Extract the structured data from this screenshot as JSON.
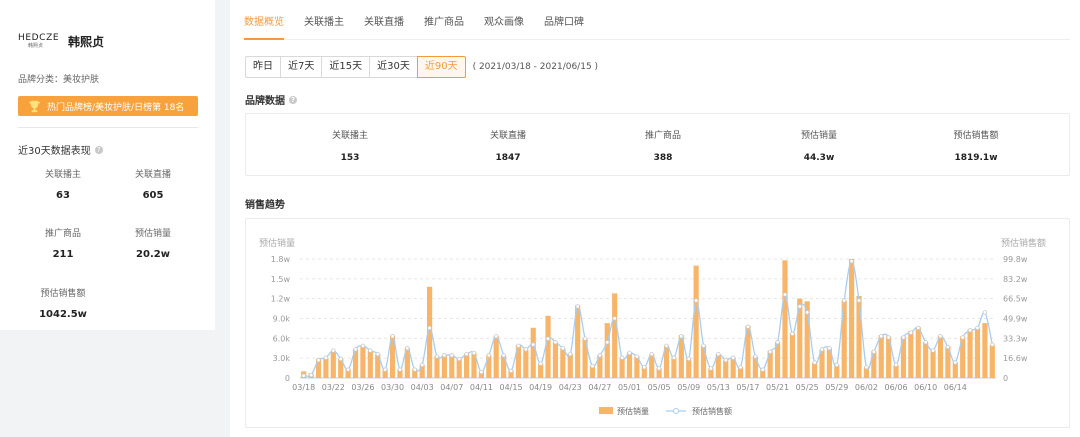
{
  "sidebar": {
    "logo_text": "HEDCZE",
    "logo_sub": "韩熙贞",
    "brand_name": "韩熙贞",
    "category": "品牌分类：美妆护肤",
    "rank_banner": "热门品牌榜/美妆护肤/日榜第 18名",
    "performance_title": "近30天数据表现",
    "stats": [
      {
        "label": "关联播主",
        "value": "63"
      },
      {
        "label": "关联直播",
        "value": "605"
      },
      {
        "label": "推广商品",
        "value": "211"
      },
      {
        "label": "预估销量",
        "value": "20.2w"
      },
      {
        "label": "预估销售额",
        "value": "1042.5w"
      }
    ]
  },
  "tabs": [
    "数据概览",
    "关联播主",
    "关联直播",
    "推广商品",
    "观众画像",
    "品牌口碑"
  ],
  "active_tab": 0,
  "ranges": [
    "昨日",
    "近7天",
    "近15天",
    "近30天",
    "近90天"
  ],
  "active_range": 4,
  "date_range": "( 2021/03/18 - 2021/06/15 )",
  "brand_data": {
    "title": "品牌数据",
    "stats": [
      {
        "label": "关联播主",
        "value": "153"
      },
      {
        "label": "关联直播",
        "value": "1847"
      },
      {
        "label": "推广商品",
        "value": "388"
      },
      {
        "label": "预估销量",
        "value": "44.3w"
      },
      {
        "label": "预估销售额",
        "value": "1819.1w"
      }
    ]
  },
  "trend_title": "销售趋势",
  "colors": {
    "accent": "#f59a3b",
    "bar": "#f7b56a",
    "line": "#a9cdf0"
  },
  "chart_data": {
    "type": "bar",
    "ylabel": "预估销量",
    "y2label": "预估销售额",
    "yticks": [
      "0",
      "3.0k",
      "6.0k",
      "9.0k",
      "1.2w",
      "1.5w",
      "1.8w"
    ],
    "y2ticks": [
      "0",
      "16.6w",
      "33.3w",
      "49.9w",
      "66.5w",
      "83.2w",
      "99.8w"
    ],
    "ylim": [
      0,
      18000
    ],
    "y2lim": [
      0,
      998000
    ],
    "xticks": [
      "03/18",
      "03/22",
      "03/26",
      "03/30",
      "04/03",
      "04/07",
      "04/11",
      "04/15",
      "04/19",
      "04/23",
      "04/27",
      "05/01",
      "05/05",
      "05/09",
      "05/13",
      "05/17",
      "05/21",
      "05/25",
      "05/29",
      "06/02",
      "06/06",
      "06/10",
      "06/14"
    ],
    "legend": [
      "预估销量",
      "预估销售额"
    ],
    "series": [
      {
        "name": "预估销量",
        "values": [
          1000,
          700,
          2900,
          3100,
          4100,
          2900,
          1400,
          4400,
          4900,
          4100,
          3600,
          1400,
          6400,
          1300,
          4600,
          1400,
          2000,
          13800,
          3300,
          3400,
          3500,
          2900,
          3700,
          3800,
          1000,
          3500,
          6400,
          3400,
          1200,
          5000,
          4300,
          7600,
          2200,
          9400,
          5400,
          4500,
          3700,
          11000,
          6000,
          1800,
          3500,
          8300,
          12800,
          3000,
          3900,
          3300,
          1700,
          3600,
          1500,
          4900,
          3100,
          6500,
          2900,
          17000,
          4900,
          1500,
          3600,
          2700,
          3100,
          1700,
          7900,
          3300,
          1300,
          4100,
          5400,
          17800,
          6800,
          12000,
          11600,
          2300,
          4300,
          4500,
          2000,
          11700,
          18000,
          12400,
          1700,
          4100,
          6500,
          6300,
          2000,
          6300,
          7100,
          7700,
          5400,
          4200,
          6400,
          4800,
          2400,
          6300,
          7400,
          7600,
          8300,
          5000
        ]
      },
      {
        "name": "预估销售额",
        "values": [
          20000,
          25000,
          150000,
          170000,
          230000,
          160000,
          70000,
          240000,
          270000,
          230000,
          200000,
          70000,
          350000,
          70000,
          250000,
          70000,
          110000,
          420000,
          180000,
          190000,
          190000,
          160000,
          200000,
          210000,
          50000,
          190000,
          350000,
          190000,
          60000,
          270000,
          240000,
          280000,
          120000,
          330000,
          300000,
          250000,
          200000,
          600000,
          330000,
          100000,
          190000,
          300000,
          500000,
          170000,
          210000,
          180000,
          90000,
          200000,
          80000,
          270000,
          170000,
          350000,
          160000,
          650000,
          270000,
          80000,
          200000,
          150000,
          170000,
          90000,
          430000,
          180000,
          70000,
          220000,
          300000,
          700000,
          370000,
          600000,
          550000,
          130000,
          240000,
          250000,
          110000,
          650000,
          980000,
          650000,
          90000,
          220000,
          350000,
          340000,
          110000,
          340000,
          380000,
          420000,
          300000,
          230000,
          350000,
          260000,
          130000,
          340000,
          400000,
          420000,
          550000,
          280000
        ]
      }
    ]
  }
}
